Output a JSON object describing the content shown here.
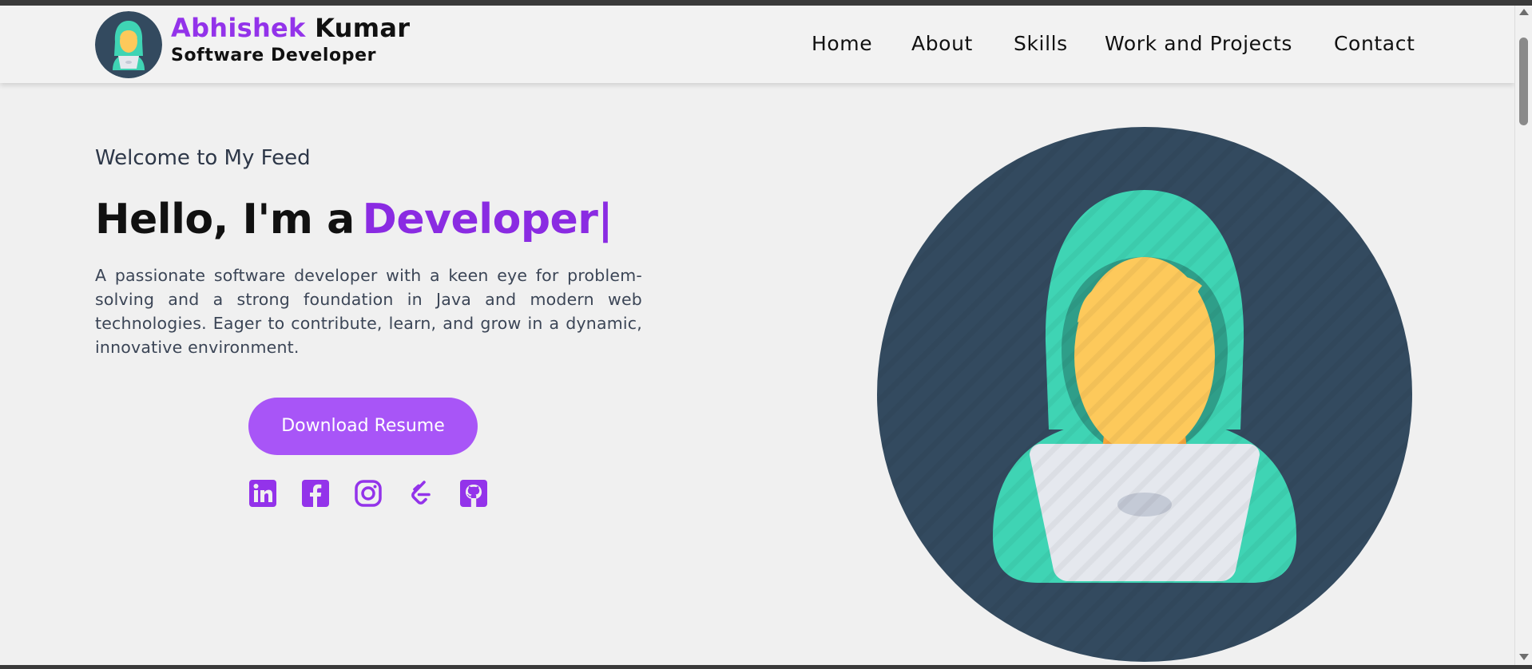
{
  "header": {
    "brand_first": "Abhishek",
    "brand_last": "Kumar",
    "role": "Software Developer",
    "nav": [
      "Home",
      "About",
      "Skills",
      "Work and Projects",
      "Contact"
    ]
  },
  "hero": {
    "welcome": "Welcome to My Feed",
    "greeting": "Hello, I'm a",
    "typed_role": "Developer",
    "cursor": "|",
    "bio": "A passionate software developer with a keen eye for problem-solving and a strong foundation in Java and modern web technologies. Eager to contribute, learn, and grow in a dynamic, innovative environment.",
    "resume_button": "Download Resume",
    "socials": [
      "linkedin-icon",
      "facebook-icon",
      "instagram-icon",
      "leetcode-icon",
      "github-icon"
    ]
  },
  "colors": {
    "accent": "#9333ea",
    "button": "#a855f7",
    "avatar_bg": "#334a5f",
    "hood": "#3fd4b4",
    "face": "#fdc95b",
    "laptop": "#e5e8ee"
  }
}
